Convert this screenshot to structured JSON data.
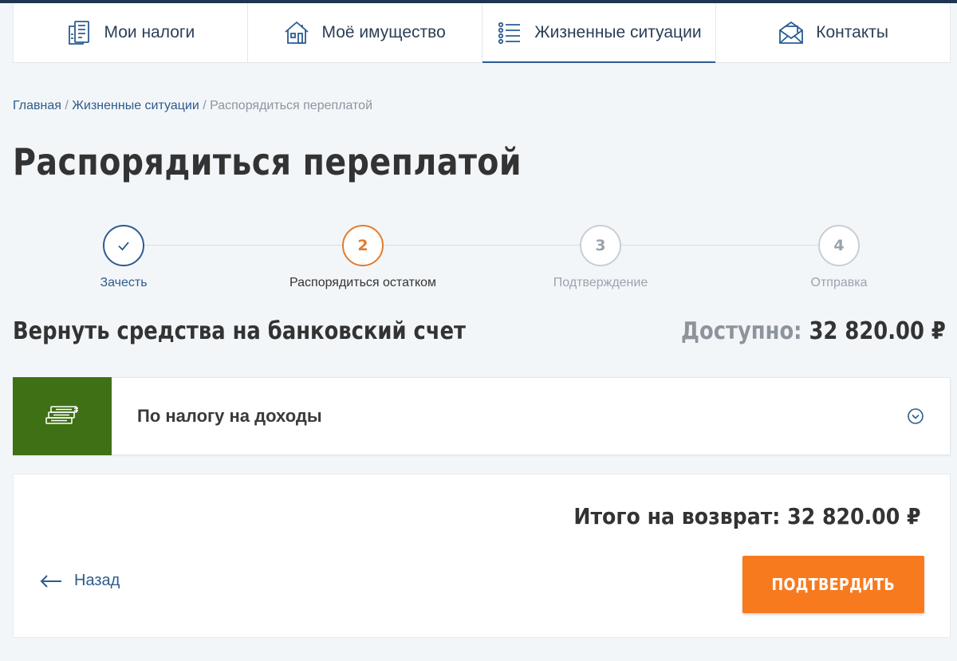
{
  "nav": {
    "items": [
      {
        "label": "Мои налоги",
        "icon": "tax-documents-icon",
        "active": false
      },
      {
        "label": "Моё имущество",
        "icon": "house-icon",
        "active": false
      },
      {
        "label": "Жизненные ситуации",
        "icon": "list-icon",
        "active": true
      },
      {
        "label": "Контакты",
        "icon": "envelope-icon",
        "active": false
      }
    ]
  },
  "breadcrumb": {
    "home": "Главная",
    "separator": " / ",
    "section": "Жизненные ситуации",
    "current": "Распорядиться переплатой"
  },
  "page": {
    "title": "Распорядиться переплатой"
  },
  "stepper": {
    "steps": [
      {
        "number": "1",
        "label": "Зачесть",
        "state": "done"
      },
      {
        "number": "2",
        "label": "Распорядиться остатком",
        "state": "current"
      },
      {
        "number": "3",
        "label": "Подтверждение",
        "state": "pending"
      },
      {
        "number": "4",
        "label": "Отправка",
        "state": "pending"
      }
    ]
  },
  "section": {
    "title": "Вернуть средства на банковский счет",
    "available_label": "Доступно:",
    "available_amount": "32 820.00 ₽"
  },
  "accordion": {
    "title": "По налогу на доходы",
    "icon": "money-stack-icon",
    "icon_bg": "#3f7016"
  },
  "summary": {
    "total_label": "Итого на возврат:",
    "total_amount": "32 820.00 ₽"
  },
  "actions": {
    "back_label": "Назад",
    "confirm_label": "ПОДТВЕРДИТЬ"
  },
  "colors": {
    "accent": "#f87a1f",
    "primary": "#2c5c92",
    "step_current": "#e27c2e"
  }
}
